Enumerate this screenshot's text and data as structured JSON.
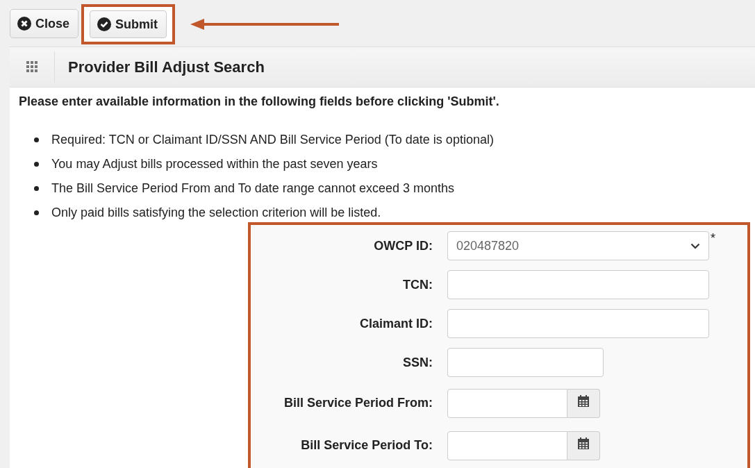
{
  "toolbar": {
    "buttons": [
      {
        "label": "Close",
        "kind": "close",
        "highlighted": false
      },
      {
        "label": "Submit",
        "kind": "submit",
        "highlighted": true
      }
    ]
  },
  "header": {
    "title": "Provider Bill Adjust Search"
  },
  "instruction": "Please enter available information in the following fields before clicking 'Submit'.",
  "notes": [
    "Required: TCN or Claimant ID/SSN AND Bill Service Period (To date is optional)",
    "You may Adjust bills processed within the past seven years",
    "The Bill Service Period From and To date range cannot exceed 3 months",
    "Only paid bills satisfying the selection criterion will be listed."
  ],
  "form": {
    "highlighted": true,
    "fields": [
      {
        "label": "OWCP ID:",
        "kind": "select",
        "value": "020487820",
        "required_mark": "*"
      },
      {
        "label": "TCN:",
        "kind": "text"
      },
      {
        "label": "Claimant ID:",
        "kind": "text"
      },
      {
        "label": "SSN:",
        "kind": "short_text"
      },
      {
        "label": "Bill Service Period From:",
        "kind": "date"
      },
      {
        "label": "Bill Service Period To:",
        "kind": "date"
      }
    ]
  }
}
